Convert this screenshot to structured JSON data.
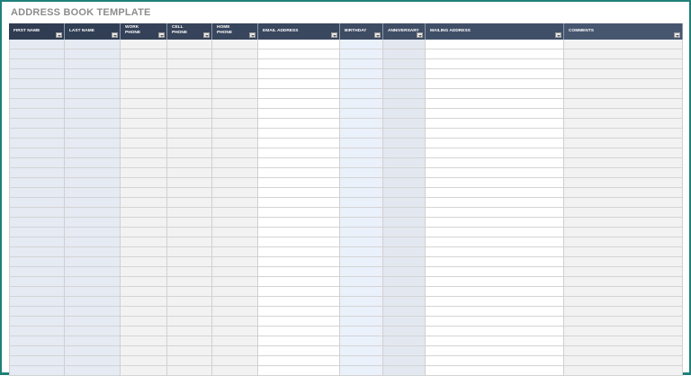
{
  "title": "ADDRESS BOOK TEMPLATE",
  "accent_border": "#1f8079",
  "columns": [
    {
      "label": "FIRST NAME",
      "fill": "#e5eaf3"
    },
    {
      "label": "LAST NAME",
      "fill": "#e5eaf3"
    },
    {
      "label": "WORK\nPHONE",
      "fill": "#f2f2f2"
    },
    {
      "label": "CELL\nPHONE",
      "fill": "#f2f2f2"
    },
    {
      "label": "HOME\nPHONE",
      "fill": "#f2f2f2"
    },
    {
      "label": "EMAIL ADDRESS",
      "fill": "#ffffff"
    },
    {
      "label": "BIRTHDAY",
      "fill": "#ebf1fb"
    },
    {
      "label": "ANNIVERSARY",
      "fill": "#e3e8f0"
    },
    {
      "label": "MAILING ADDRESS",
      "fill": "#ffffff"
    },
    {
      "label": "COMMENTS",
      "fill": "#f2f2f2"
    }
  ],
  "header_colors": [
    "#2f3c52",
    "#4b5b75"
  ],
  "empty_rows": 34
}
